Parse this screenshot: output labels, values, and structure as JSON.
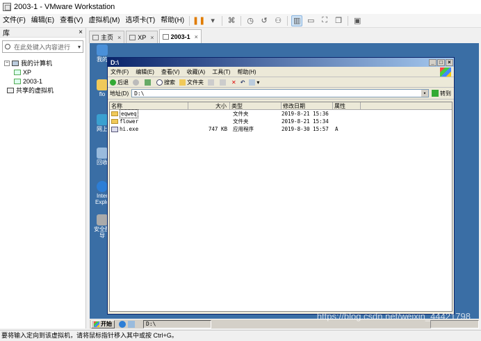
{
  "window": {
    "title": "2003-1 - VMware Workstation"
  },
  "host_menu": [
    "文件(F)",
    "编辑(E)",
    "查看(V)",
    "虚拟机(M)",
    "选项卡(T)",
    "帮助(H)"
  ],
  "library": {
    "title": "库",
    "close": "×",
    "search_placeholder": "在此处键入内容进行",
    "tree": [
      {
        "label": "我的计算机",
        "level": 0
      },
      {
        "label": "XP",
        "level": 1
      },
      {
        "label": "2003-1",
        "level": 1
      },
      {
        "label": "共享的虚拟机",
        "level": 0
      }
    ]
  },
  "tabs": [
    {
      "label": "主页",
      "close": "×"
    },
    {
      "label": "XP",
      "close": "×"
    },
    {
      "label": "2003-1",
      "close": "×"
    }
  ],
  "desktop_icons": [
    {
      "label": "我的",
      "color": "#4a90d9"
    },
    {
      "label": "flo",
      "color": "#f0c95a"
    },
    {
      "label": "网上",
      "color": "#3aa0d0"
    },
    {
      "label": "回收",
      "color": "#9bd"
    },
    {
      "label": "Inter Explo",
      "color": "#2d7ed6"
    },
    {
      "label": "安全配 导",
      "color": "#aaa"
    }
  ],
  "explorer": {
    "title": "D:\\",
    "menu": [
      "文件(F)",
      "编辑(E)",
      "查看(V)",
      "收藏(A)",
      "工具(T)",
      "帮助(H)"
    ],
    "toolbar": {
      "back": "后退",
      "search": "搜索",
      "folders": "文件夹"
    },
    "address_label": "地址(D)",
    "address_value": "D:\\",
    "go_label": "转到",
    "columns": [
      "名称",
      "大小",
      "类型",
      "修改日期",
      "属性"
    ],
    "files": [
      {
        "name": "eqweq",
        "size": "",
        "type": "文件夹",
        "date": "2019-8-21 15:36",
        "attr": "",
        "kind": "folder"
      },
      {
        "name": "flower",
        "size": "",
        "type": "文件夹",
        "date": "2019-8-21 15:34",
        "attr": "",
        "kind": "folder"
      },
      {
        "name": "hi.exe",
        "size": "747 KB",
        "type": "应用程序",
        "date": "2019-8-30 15:57",
        "attr": "A",
        "kind": "exe"
      }
    ]
  },
  "taskbar": {
    "start": "开始",
    "task": "D:\\"
  },
  "watermark": "https://blog.csdn.net/weixin_44421798",
  "status": "要将输入定向到该虚拟机，请将鼠标指针移入其中或按 Ctrl+G。"
}
